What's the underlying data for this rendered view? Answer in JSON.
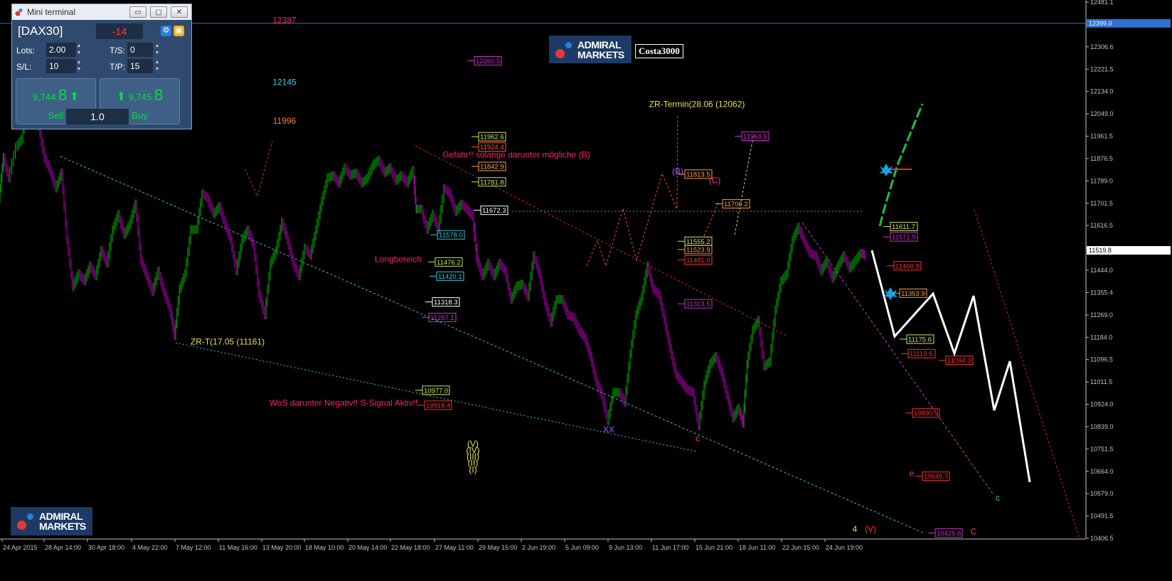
{
  "window": {
    "title": "Mini terminal",
    "buttons": {
      "minimize": "▭",
      "restore": "▢",
      "close": "✕"
    }
  },
  "terminal": {
    "symbol": "[DAX30]",
    "spread": "-14",
    "lots_label": "Lots:",
    "lots": "2.00",
    "ts_label": "T/S:",
    "ts": "0",
    "sl_label": "S/L:",
    "sl": "10",
    "tp_label": "T/P:",
    "tp": "15",
    "sell_price_main": "9,744.",
    "sell_price_big": "8",
    "buy_price_main": "9,745.",
    "buy_price_big": "8",
    "sell_label": "Sell",
    "buy_label": "Buy",
    "volume": "1.0"
  },
  "branding": {
    "logo_line1": "ADMIRAL",
    "logo_line2": "MARKETS",
    "username": "Costa3000"
  },
  "colors": {
    "background": "#000000",
    "bull": "#00c000",
    "bear": "#c000c0",
    "cyan": "#33c8d8",
    "red": "#e02020",
    "yellow": "#e8e050",
    "pink": "#ff2070",
    "axis": "#c0c0c0",
    "current_price_line": "#2f6fd0"
  },
  "chart_data": {
    "type": "line",
    "title": "",
    "price_axis": {
      "ylim": [
        10404.6,
        12481.1
      ],
      "ticks": [
        "12481.1",
        "12399.0",
        "12306.6",
        "12221.5",
        "12134.0",
        "12049.0",
        "11961.5",
        "11876.5",
        "11789.0",
        "11701.5",
        "11616.5",
        "11519.8",
        "11444.0",
        "11355.4",
        "11269.0",
        "11184.0",
        "11096.5",
        "11011.5",
        "10924.0",
        "10839.0",
        "10751.5",
        "10664.0",
        "10579.0",
        "10491.5",
        "10406.5"
      ],
      "current_price": "11519.8",
      "upper_line_price": "12399.0"
    },
    "time_axis": {
      "ticks": [
        "24 Apr 2015",
        "28 Apr 14:00",
        "30 Apr 18:00",
        "4 May 22:00",
        "7 May 12:00",
        "11 May 16:00",
        "13 May 20:00",
        "18 May 10:00",
        "20 May 14:00",
        "22 May 18:00",
        "27 May 11:00",
        "29 May 15:00",
        "2 Jun 19:00",
        "5 Jun 09:00",
        "9 Jun 13:00",
        "11 Jun 17:00",
        "15 Jun 21:00",
        "18 Jun 11:00",
        "22 Jun 15:00",
        "24 Jun 19:00"
      ]
    },
    "price_path": [
      [
        0,
        11720
      ],
      [
        6,
        11880
      ],
      [
        14,
        11800
      ],
      [
        24,
        11920
      ],
      [
        32,
        11950
      ],
      [
        40,
        12100
      ],
      [
        48,
        12060
      ],
      [
        56,
        12000
      ],
      [
        64,
        11880
      ],
      [
        72,
        11830
      ],
      [
        80,
        11760
      ],
      [
        88,
        11820
      ],
      [
        96,
        11560
      ],
      [
        104,
        11380
      ],
      [
        112,
        11430
      ],
      [
        120,
        11400
      ],
      [
        128,
        11460
      ],
      [
        136,
        11420
      ],
      [
        144,
        11520
      ],
      [
        152,
        11470
      ],
      [
        160,
        11600
      ],
      [
        168,
        11660
      ],
      [
        176,
        11580
      ],
      [
        184,
        11620
      ],
      [
        192,
        11700
      ],
      [
        200,
        11480
      ],
      [
        208,
        11420
      ],
      [
        216,
        11360
      ],
      [
        224,
        11440
      ],
      [
        232,
        11360
      ],
      [
        240,
        11300
      ],
      [
        247,
        11190
      ],
      [
        254,
        11370
      ],
      [
        262,
        11430
      ],
      [
        270,
        11600
      ],
      [
        278,
        11600
      ],
      [
        286,
        11740
      ],
      [
        294,
        11720
      ],
      [
        302,
        11660
      ],
      [
        310,
        11690
      ],
      [
        318,
        11620
      ],
      [
        326,
        11560
      ],
      [
        334,
        11440
      ],
      [
        342,
        11560
      ],
      [
        350,
        11600
      ],
      [
        358,
        11540
      ],
      [
        366,
        11350
      ],
      [
        374,
        11270
      ],
      [
        382,
        11470
      ],
      [
        390,
        11520
      ],
      [
        398,
        11630
      ],
      [
        406,
        11560
      ],
      [
        414,
        11470
      ],
      [
        422,
        11420
      ],
      [
        430,
        11530
      ],
      [
        438,
        11500
      ],
      [
        446,
        11600
      ],
      [
        454,
        11710
      ],
      [
        462,
        11800
      ],
      [
        470,
        11810
      ],
      [
        478,
        11780
      ],
      [
        486,
        11840
      ],
      [
        494,
        11810
      ],
      [
        502,
        11820
      ],
      [
        510,
        11780
      ],
      [
        518,
        11800
      ],
      [
        526,
        11850
      ],
      [
        534,
        11870
      ],
      [
        542,
        11820
      ],
      [
        550,
        11840
      ],
      [
        558,
        11790
      ],
      [
        566,
        11810
      ],
      [
        574,
        11780
      ],
      [
        582,
        11830
      ],
      [
        586,
        11680
      ],
      [
        594,
        11680
      ],
      [
        602,
        11600
      ],
      [
        610,
        11660
      ],
      [
        618,
        11600
      ],
      [
        626,
        11760
      ],
      [
        634,
        11740
      ],
      [
        642,
        11670
      ],
      [
        650,
        11700
      ],
      [
        658,
        11680
      ],
      [
        666,
        11650
      ],
      [
        672,
        11490
      ],
      [
        680,
        11420
      ],
      [
        688,
        11470
      ],
      [
        696,
        11420
      ],
      [
        704,
        11470
      ],
      [
        712,
        11440
      ],
      [
        720,
        11330
      ],
      [
        728,
        11380
      ],
      [
        736,
        11390
      ],
      [
        744,
        11340
      ],
      [
        752,
        11500
      ],
      [
        760,
        11430
      ],
      [
        768,
        11320
      ],
      [
        776,
        11240
      ],
      [
        784,
        11330
      ],
      [
        792,
        11330
      ],
      [
        800,
        11270
      ],
      [
        808,
        11260
      ],
      [
        816,
        11210
      ],
      [
        824,
        11180
      ],
      [
        832,
        11110
      ],
      [
        840,
        11010
      ],
      [
        848,
        10960
      ],
      [
        856,
        10860
      ],
      [
        864,
        10970
      ],
      [
        872,
        10970
      ],
      [
        880,
        10930
      ],
      [
        888,
        11120
      ],
      [
        896,
        11270
      ],
      [
        904,
        11340
      ],
      [
        912,
        11460
      ],
      [
        920,
        11370
      ],
      [
        928,
        11350
      ],
      [
        936,
        11250
      ],
      [
        944,
        11140
      ],
      [
        952,
        11040
      ],
      [
        960,
        11010
      ],
      [
        968,
        10980
      ],
      [
        976,
        10970
      ],
      [
        984,
        10840
      ],
      [
        992,
        11000
      ],
      [
        1000,
        11080
      ],
      [
        1008,
        11110
      ],
      [
        1016,
        11050
      ],
      [
        1024,
        10960
      ],
      [
        1032,
        10870
      ],
      [
        1040,
        10910
      ],
      [
        1046,
        10850
      ],
      [
        1052,
        11080
      ],
      [
        1060,
        11210
      ],
      [
        1068,
        11250
      ],
      [
        1076,
        11070
      ],
      [
        1084,
        11090
      ],
      [
        1092,
        11290
      ],
      [
        1100,
        11400
      ],
      [
        1108,
        11430
      ],
      [
        1116,
        11560
      ],
      [
        1124,
        11610
      ],
      [
        1132,
        11560
      ],
      [
        1140,
        11510
      ],
      [
        1148,
        11500
      ],
      [
        1156,
        11440
      ],
      [
        1164,
        11480
      ],
      [
        1172,
        11410
      ],
      [
        1180,
        11460
      ],
      [
        1188,
        11500
      ],
      [
        1196,
        11450
      ],
      [
        1204,
        11480
      ],
      [
        1212,
        11510
      ],
      [
        1218,
        11500
      ]
    ],
    "levels": [
      {
        "text": "12260.5",
        "color": "#d030d0",
        "xpx": 667,
        "price": 12254
      },
      {
        "text": "11962.6",
        "color": "#c8e860",
        "xpx": 673,
        "price": 11960
      },
      {
        "text": "11924.4",
        "color": "#ff6020",
        "xpx": 673,
        "price": 11920
      },
      {
        "text": "11842.9",
        "color": "#ffa040",
        "xpx": 673,
        "price": 11845
      },
      {
        "text": "11781.8",
        "color": "#c8e860",
        "xpx": 673,
        "price": 11785
      },
      {
        "text": "11672.3",
        "color": "#ffffff",
        "xpx": 676,
        "price": 11675
      },
      {
        "text": "11578.0",
        "color": "#33c8d8",
        "xpx": 615,
        "price": 11580
      },
      {
        "text": "11476.2",
        "color": "#c8e860",
        "xpx": 612,
        "price": 11475
      },
      {
        "text": "11420.1",
        "color": "#33c8d8",
        "xpx": 614,
        "price": 11420
      },
      {
        "text": "11318.3",
        "color": "#ffffff",
        "xpx": 608,
        "price": 11320
      },
      {
        "text": "11257.1",
        "color": "#d030d0",
        "xpx": 603,
        "price": 11260
      },
      {
        "text": "10977.0",
        "color": "#c8e860",
        "xpx": 594,
        "price": 10978
      },
      {
        "text": "10918.4",
        "color": "#ff3030",
        "xpx": 597,
        "price": 10920
      },
      {
        "text": "11964.5",
        "color": "#d030d0",
        "xpx": 1043,
        "price": 11962
      },
      {
        "text": "11813.5",
        "color": "#ffa040",
        "xpx": 963,
        "price": 11815
      },
      {
        "text": "11700.2",
        "color": "#ffa040",
        "xpx": 1016,
        "price": 11700
      },
      {
        "text": "11555.2",
        "color": "#c8e860",
        "xpx": 963,
        "price": 11555
      },
      {
        "text": "11523.9",
        "color": "#ffa040",
        "xpx": 963,
        "price": 11523
      },
      {
        "text": "11481.0",
        "color": "#ff3030",
        "xpx": 963,
        "price": 11483
      },
      {
        "text": "11313.5",
        "color": "#d030d0",
        "xpx": 963,
        "price": 11313
      },
      {
        "text": "11611.7",
        "color": "#c8e860",
        "xpx": 1252,
        "price": 11612
      },
      {
        "text": "11571.9",
        "color": "#d030d0",
        "xpx": 1252,
        "price": 11572
      },
      {
        "text": "11460.9",
        "color": "#ff3030",
        "xpx": 1257,
        "price": 11460
      },
      {
        "text": "11353.9",
        "color": "#ffa040",
        "xpx": 1265,
        "price": 11354
      },
      {
        "text": "11175.6",
        "color": "#c8e860",
        "xpx": 1275,
        "price": 11176
      },
      {
        "text": "11119.6",
        "color": "#ff3030",
        "xpx": 1277,
        "price": 11120
      },
      {
        "text": "11094.3",
        "color": "#ff3030",
        "xpx": 1330,
        "price": 11094
      },
      {
        "text": "10890.9",
        "color": "#ff3030",
        "xpx": 1283,
        "price": 10890
      },
      {
        "text": "10645.7",
        "color": "#ff3030",
        "xpx": 1297,
        "price": 10645
      },
      {
        "text": "10425.6",
        "color": "#d030d0",
        "xpx": 1315,
        "price": 10425
      }
    ],
    "annotations": [
      {
        "text": "12387",
        "color": "#ff2070",
        "xpx": 400,
        "price": 12400
      },
      {
        "text": "12145",
        "color": "#33d8e8",
        "xpx": 400,
        "price": 12160
      },
      {
        "text": "11996",
        "color": "#ff8020",
        "xpx": 400,
        "price": 12010
      },
      {
        "text": "Gefahr!! solange darunter mögliche (B)",
        "color": "#ff2070",
        "xpx": 726,
        "price": 11880
      },
      {
        "text": "ZR-Termin(28.06  (12062)",
        "color": "#e8e050",
        "xpx": 980,
        "price": 12075
      },
      {
        "text": "Longbereich",
        "color": "#ff2070",
        "xpx": 560,
        "price": 11475
      },
      {
        "text": "ZR-T(17.05  (11161)",
        "color": "#e8e050",
        "xpx": 320,
        "price": 11155
      },
      {
        "text": "WoS darunter Negativ!! S-Signal Aktiv!!",
        "color": "#ff2070",
        "xpx": 483,
        "price": 10918
      },
      {
        "text": "(B)",
        "color": "#a060ff",
        "xpx": 953,
        "price": 11815
      },
      {
        "text": "(C)",
        "color": "#ff3080",
        "xpx": 1005,
        "price": 11780
      },
      {
        "text": "XX",
        "color": "#a060ff",
        "xpx": 856,
        "price": 10815
      },
      {
        "text": "c",
        "color": "#ff3080",
        "xpx": 981,
        "price": 10780
      },
      {
        "text": "(V)",
        "color": "#e8e050",
        "xpx": 665,
        "price": 10760
      },
      {
        "text": "(IV)",
        "color": "#e8e050",
        "xpx": 665,
        "price": 10735
      },
      {
        "text": "(III)",
        "color": "#e8e050",
        "xpx": 665,
        "price": 10710
      },
      {
        "text": "(II)",
        "color": "#e8e050",
        "xpx": 665,
        "price": 10685
      },
      {
        "text": "(I)",
        "color": "#e8e050",
        "xpx": 665,
        "price": 10660
      },
      {
        "text": "e",
        "color": "#ff3080",
        "xpx": 1282,
        "price": 10645
      },
      {
        "text": "c",
        "color": "#33c8d8",
        "xpx": 1403,
        "price": 10550
      },
      {
        "text": "4",
        "color": "#e8e050",
        "xpx": 1202,
        "price": 10430
      },
      {
        "text": "(V)",
        "color": "#ff3030",
        "xpx": 1224,
        "price": 10430
      },
      {
        "text": "C",
        "color": "#ff3080",
        "xpx": 1369,
        "price": 10420
      }
    ]
  }
}
